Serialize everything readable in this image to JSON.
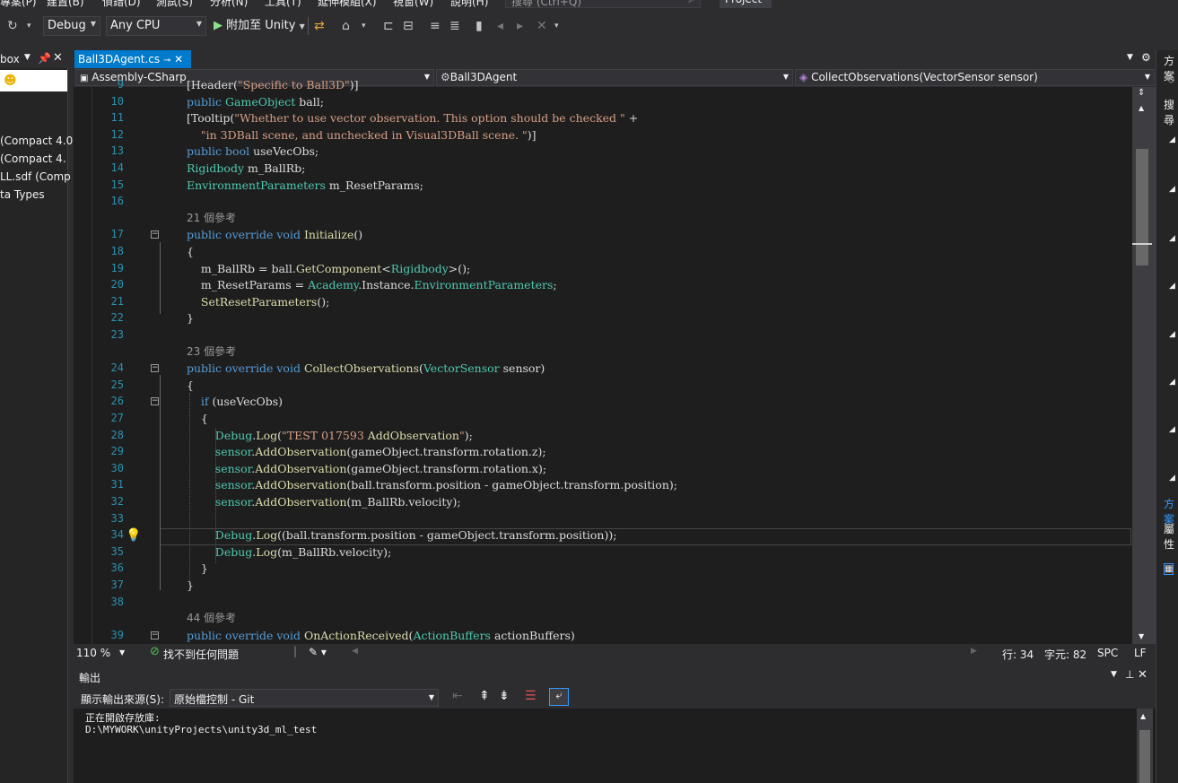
{
  "menubar": {
    "items": [
      "專案(P)",
      "建置(B)",
      "偵錯(D)",
      "測試(S)",
      "分析(N)",
      "工具(T)",
      "延伸模組(X)",
      "視窗(W)",
      "說明(H)"
    ],
    "search_placeholder": "搜尋 (Ctrl+Q)",
    "project_label": "Project"
  },
  "toolbar": {
    "config": "Debug",
    "platform": "Any CPU",
    "attach": "附加至 Unity"
  },
  "toolbox": {
    "title": "box",
    "items": [
      "(Compact 4.0",
      "(Compact 4.",
      "LL.sdf (Comp",
      "ta Types"
    ]
  },
  "editor": {
    "tab": "Ball3DAgent.cs",
    "nav_project": "Assembly-CSharp",
    "nav_class": "Ball3DAgent",
    "nav_member": "CollectObservations(VectorSensor sensor)",
    "lines": [
      {
        "n": "9",
        "t": "[Header(\"Specific to Ball3D\")]"
      },
      {
        "n": "10",
        "t": "public GameObject ball;"
      },
      {
        "n": "11",
        "t": "[Tooltip(\"Whether to use vector observation. This option should be checked \" +"
      },
      {
        "n": "12",
        "t": "    \"in 3DBall scene, and unchecked in Visual3DBall scene. \")]"
      },
      {
        "n": "13",
        "t": "public bool useVecObs;"
      },
      {
        "n": "14",
        "t": "Rigidbody m_BallRb;"
      },
      {
        "n": "15",
        "t": "EnvironmentParameters m_ResetParams;"
      },
      {
        "n": "16",
        "t": ""
      },
      {
        "n": "",
        "t": "21 個參考"
      },
      {
        "n": "17",
        "t": "public override void Initialize()"
      },
      {
        "n": "18",
        "t": "{"
      },
      {
        "n": "19",
        "t": "    m_BallRb = ball.GetComponent<Rigidbody>();"
      },
      {
        "n": "20",
        "t": "    m_ResetParams = Academy.Instance.EnvironmentParameters;"
      },
      {
        "n": "21",
        "t": "    SetResetParameters();"
      },
      {
        "n": "22",
        "t": "}"
      },
      {
        "n": "23",
        "t": ""
      },
      {
        "n": "",
        "t": "23 個參考"
      },
      {
        "n": "24",
        "t": "public override void CollectObservations(VectorSensor sensor)"
      },
      {
        "n": "25",
        "t": "{"
      },
      {
        "n": "26",
        "t": "    if (useVecObs)"
      },
      {
        "n": "27",
        "t": "    {"
      },
      {
        "n": "28",
        "t": "        Debug.Log(\"TEST 017593 AddObservation\");"
      },
      {
        "n": "29",
        "t": "        sensor.AddObservation(gameObject.transform.rotation.z);"
      },
      {
        "n": "30",
        "t": "        sensor.AddObservation(gameObject.transform.rotation.x);"
      },
      {
        "n": "31",
        "t": "        sensor.AddObservation(ball.transform.position - gameObject.transform.position);"
      },
      {
        "n": "32",
        "t": "        sensor.AddObservation(m_BallRb.velocity);"
      },
      {
        "n": "33",
        "t": ""
      },
      {
        "n": "34",
        "t": "        Debug.Log((ball.transform.position - gameObject.transform.position));"
      },
      {
        "n": "35",
        "t": "        Debug.Log(m_BallRb.velocity);"
      },
      {
        "n": "36",
        "t": "    }"
      },
      {
        "n": "37",
        "t": "}"
      },
      {
        "n": "38",
        "t": ""
      },
      {
        "n": "",
        "t": "44 個參考"
      },
      {
        "n": "39",
        "t": "public override void OnActionReceived(ActionBuffers actionBuffers)"
      }
    ]
  },
  "status": {
    "zoom": "110 %",
    "issues": "找不到任何問題",
    "line": "行: 34",
    "char": "字元: 82",
    "spc": "SPC",
    "lf": "LF"
  },
  "output": {
    "title": "輸出",
    "source_label": "顯示輸出來源(S):",
    "source_value": "原始檔控制 - Git",
    "lines": [
      "正在開啟存放庫:",
      "D:\\MYWORK\\unityProjects\\unity3d_ml_test"
    ]
  },
  "right_panel": {
    "title": "方案",
    "search": "搜尋",
    "tab2": "方案",
    "tab3": "屬性"
  }
}
